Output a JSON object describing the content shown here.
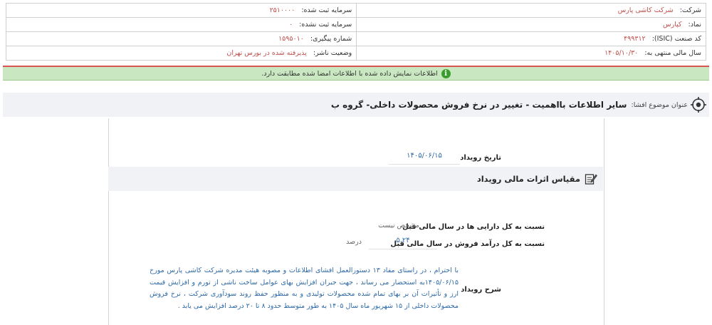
{
  "company": {
    "company_label": "شرکت:",
    "company_value": "شرکت کاشی پارس",
    "symbol_label": "نماد:",
    "symbol_value": "کپارس",
    "isic_label": "کد صنعت (ISIC):",
    "isic_value": "۴۹۹۳۱۲",
    "fiscal_label": "سال مالی منتهی به:",
    "fiscal_value": "۱۴۰۵/۱۰/۳۰",
    "registered_capital_label": "سرمایه ثبت شده:",
    "registered_capital_value": "۲۵۱۰۰۰۰",
    "unregistered_capital_label": "سرمایه ثبت نشده:",
    "unregistered_capital_value": "۰",
    "tracking_label": "شماره پیگیری:",
    "tracking_value": "۱۵۹۵۰۱۰",
    "publisher_status_label": "وضعیت ناشر:",
    "publisher_status_value": "پذیرفته شده در بورس تهران"
  },
  "notice": {
    "icon": "info-icon",
    "text": "اطلاعات نمایش داده شده با اطلاعات امضا شده مطابقت دارد."
  },
  "subject": {
    "icon": "target-icon",
    "label": "عنوان موضوع افشا:",
    "title": "سایر اطلاعات بااهمیت - تغییر در نرخ فروش محصولات داخلی- گروه ب"
  },
  "event": {
    "date_label": "تاریخ رویداد",
    "date_value": "۱۴۰۵/۰۶/۱۵"
  },
  "financial_section": {
    "icon": "edit-note-icon",
    "title": "مقیاس اثرات مالی رویداد",
    "assets_ratio_label": "نسبت به کل دارایی ها در سال مالی قبل",
    "assets_ratio_value": "مشخص نیست",
    "revenue_ratio_label": "نسبت به کل درآمد فروش در سال مالی قبل",
    "revenue_ratio_value": "۵.۲۴",
    "revenue_ratio_unit": "درصد"
  },
  "description": {
    "label": "شرح رویداد",
    "text": "با احترام ، در راستای مفاد ۱۳ دستورالعمل افشای اطلاعات و مصوبه هیئت مدیره شرکت کاشی پارس مورخ ۱۴۰۵/۰۶/۱۵به استحضار می رساند ، جهت جبران افزایش بهای عوامل ساخت ناشی از تورم و افزایش قیمت ارز و تأثیرات آن بر بهای تمام شده محصولات تولیدی و به منظور حفظ روند سودآوری شرکت ، نرخ فروش محصولات داخلی از ۱۵ شهریور ماه سال ۱۴۰۵ به طور متوسط حدود ۸ تا ۲۰ درصد افزایش می یابد ."
  }
}
